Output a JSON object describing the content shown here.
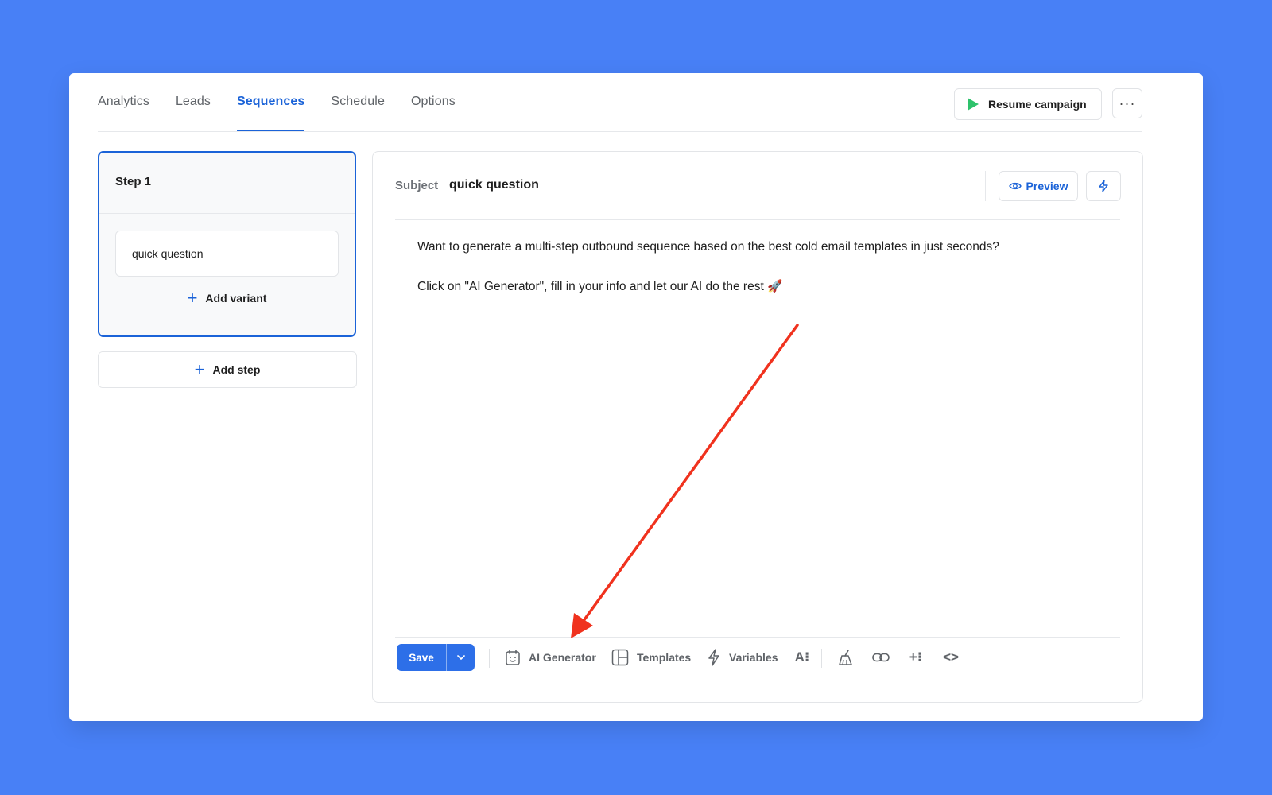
{
  "nav": {
    "tabs": [
      {
        "label": "Analytics"
      },
      {
        "label": "Leads"
      },
      {
        "label": "Sequences"
      },
      {
        "label": "Schedule"
      },
      {
        "label": "Options"
      }
    ],
    "active_tab": "Sequences",
    "resume_label": "Resume campaign",
    "more_label": "···"
  },
  "steps": {
    "step_title": "Step 1",
    "variant_subject": "quick question",
    "add_variant_label": "Add variant",
    "add_step_label": "Add step"
  },
  "editor": {
    "subject_label": "Subject",
    "subject_value": "quick question",
    "preview_label": "Preview",
    "body_lines": [
      "Want to generate a multi-step outbound sequence based on the best cold email templates in just seconds?",
      "Click on \"AI Generator\", fill in your info and let our AI do the rest 🚀"
    ]
  },
  "toolbar": {
    "save_label": "Save",
    "ai_generator_label": "AI Generator",
    "templates_label": "Templates",
    "variables_label": "Variables",
    "text_format_glyph": "A⁝",
    "insert_glyph": "+⁝",
    "code_glyph": "<>"
  },
  "colors": {
    "background": "#4880f6",
    "accent": "#1b63d8",
    "save_button": "#2d6fe8",
    "play_icon": "#2ec26b",
    "annotation_arrow": "#f0321e"
  }
}
